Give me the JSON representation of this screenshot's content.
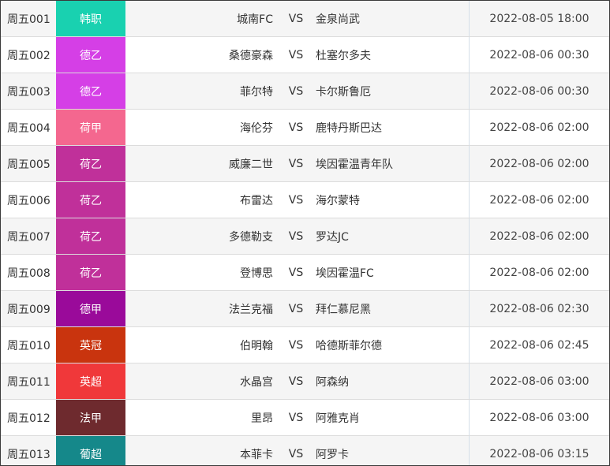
{
  "vs_label": "VS",
  "matches": [
    {
      "no": "周五001",
      "league": "韩职",
      "league_color": "#19d1b0",
      "home": "城南FC",
      "away": "金泉尚武",
      "time": "2022-08-05 18:00"
    },
    {
      "no": "周五002",
      "league": "德乙",
      "league_color": "#d53fe6",
      "home": "桑德豪森",
      "away": "杜塞尔多夫",
      "time": "2022-08-06 00:30"
    },
    {
      "no": "周五003",
      "league": "德乙",
      "league_color": "#d53fe6",
      "home": "菲尔特",
      "away": "卡尔斯鲁厄",
      "time": "2022-08-06 00:30"
    },
    {
      "no": "周五004",
      "league": "荷甲",
      "league_color": "#f4678f",
      "home": "海伦芬",
      "away": "鹿特丹斯巴达",
      "time": "2022-08-06 02:00"
    },
    {
      "no": "周五005",
      "league": "荷乙",
      "league_color": "#c0309a",
      "home": "威廉二世",
      "away": "埃因霍温青年队",
      "time": "2022-08-06 02:00"
    },
    {
      "no": "周五006",
      "league": "荷乙",
      "league_color": "#c0309a",
      "home": "布雷达",
      "away": "海尔蒙特",
      "time": "2022-08-06 02:00"
    },
    {
      "no": "周五007",
      "league": "荷乙",
      "league_color": "#c0309a",
      "home": "多德勒支",
      "away": "罗达JC",
      "time": "2022-08-06 02:00"
    },
    {
      "no": "周五008",
      "league": "荷乙",
      "league_color": "#c0309a",
      "home": "登博思",
      "away": "埃因霍温FC",
      "time": "2022-08-06 02:00"
    },
    {
      "no": "周五009",
      "league": "德甲",
      "league_color": "#9a0a9a",
      "home": "法兰克福",
      "away": "拜仁慕尼黑",
      "time": "2022-08-06 02:30"
    },
    {
      "no": "周五010",
      "league": "英冠",
      "league_color": "#c9340e",
      "home": "伯明翰",
      "away": "哈德斯菲尔德",
      "time": "2022-08-06 02:45"
    },
    {
      "no": "周五011",
      "league": "英超",
      "league_color": "#f0383a",
      "home": "水晶宫",
      "away": "阿森纳",
      "time": "2022-08-06 03:00"
    },
    {
      "no": "周五012",
      "league": "法甲",
      "league_color": "#6e2a2e",
      "home": "里昂",
      "away": "阿雅克肖",
      "time": "2022-08-06 03:00"
    },
    {
      "no": "周五013",
      "league": "葡超",
      "league_color": "#15888a",
      "home": "本菲卡",
      "away": "阿罗卡",
      "time": "2022-08-06 03:15"
    }
  ]
}
